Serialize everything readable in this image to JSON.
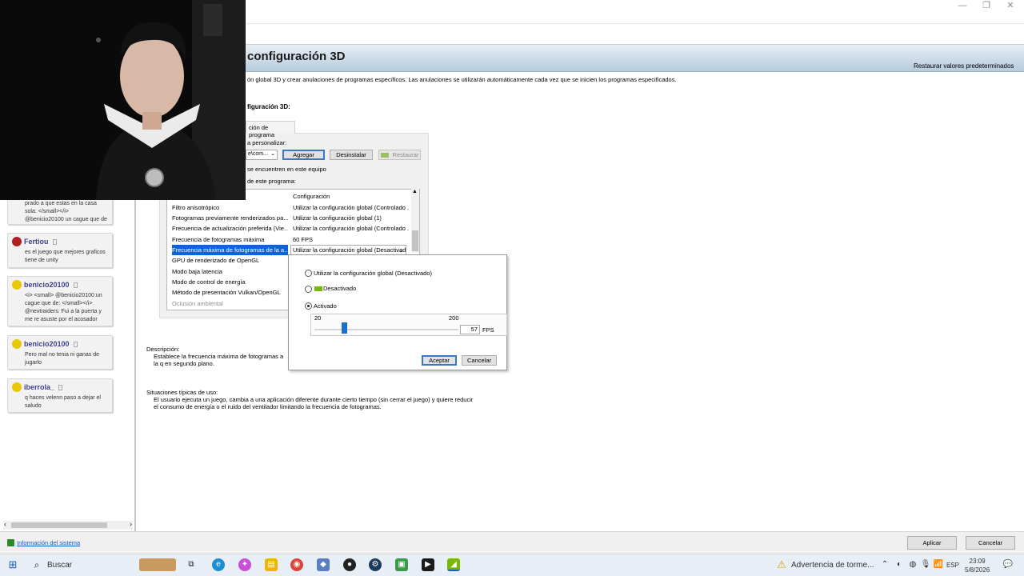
{
  "page": {
    "title": "configuración 3D",
    "restore_defaults": "Restaurar valores predeterminados",
    "intro": "ón global 3D y crear anulaciones de programas específicos. Las anulaciones se utilizarán automáticamente cada vez que se inicien los programas especificados.",
    "section_label": "figuración 3D:",
    "tab_label": "ción de programa",
    "personalize_label": "a personalizar:",
    "program_combo": "e\\com...",
    "buttons": {
      "add": "Agregar",
      "uninstall": "Desinstalar",
      "restore": "Restaurar"
    },
    "found_label": "se encuentren en este equipo",
    "settings_label": "de este programa:"
  },
  "settings_list": {
    "header": {
      "feature": "",
      "setting": "Configuración"
    },
    "rows": [
      {
        "feature": "Filtro anisotrópico",
        "setting": "Utilizar la configuración global (Controlado ..."
      },
      {
        "feature": "Fotogramas previamente renderizados pa...",
        "setting": "Utilizar la configuración global (1)"
      },
      {
        "feature": "Frecuencia de actualización preferida (Vie...",
        "setting": "Utilizar la configuración global (Controlado ..."
      },
      {
        "feature": "Frecuencia de fotogramas máxima",
        "setting": "60 FPS"
      },
      {
        "feature": "Frecuencia máxima de fotogramas de la a...",
        "setting": "Utilizar la configuración global (Desactivado"
      },
      {
        "feature": "GPU de renderizado de OpenGL",
        "setting": ""
      },
      {
        "feature": "Modo baja latencia",
        "setting": ""
      },
      {
        "feature": "Modo de control de energía",
        "setting": ""
      },
      {
        "feature": "Método de presentación Vulkan/OpenGL",
        "setting": ""
      },
      {
        "feature": "Oclusión ambiental",
        "setting": ""
      }
    ]
  },
  "popup": {
    "option_global": "Utilizar la configuración global (Desactivado)",
    "option_off": "Desactivado",
    "option_on": "Activado",
    "selected": "on",
    "min_label": "20",
    "max_label": "200",
    "value": "57",
    "unit": "FPS",
    "slider_min": 20,
    "slider_max": 200,
    "slider_value": 57,
    "accept": "Aceptar",
    "cancel": "Cancelar"
  },
  "description": {
    "title": "Descripción:",
    "text": "Establece la frecuencia máxima de fotogramas a la q en segundo plano."
  },
  "typical": {
    "title": "Situaciones típicas de uso:",
    "text": "El usuario ejecuta un juego, cambia a una aplicación diferente durante cierto tiempo (sin cerrar el juego) y quiere reducir el consumo de energía o el ruido del ventilador limitando la frecuencia de fotogramas."
  },
  "footer": {
    "system_info": "Información del sistema",
    "apply": "Aplicar",
    "cancel": "Cancelar"
  },
  "chat": [
    {
      "user": "",
      "color": "#ffffff",
      "text": "prado a que estas en la casa sola: </small></i> @benicio20100 un cague que de"
    },
    {
      "user": "Fertiou",
      "color": "#b02020",
      "text": "es el juego que mejores graficos tiene de unity"
    },
    {
      "user": "benicio20100",
      "color": "#e8c800",
      "text": "<i> <small> @benicio20100 un cague que de: </small></i> @nextraiders: Fui a la puerta y me re asuste por el acosador"
    },
    {
      "user": "benicio20100",
      "color": "#e8c800",
      "text": "Pero mal no tenia ni ganas de jugarlo"
    },
    {
      "user": "iberrola_",
      "color": "#e8c800",
      "text": "q haces velenn paso a dejar el saludo"
    }
  ],
  "taskbar": {
    "search": "Buscar",
    "weather": "Advertencia de torme...",
    "lang": "ESP",
    "time": "23:09",
    "date": "5/8/2026"
  },
  "colors": {
    "selection": "#0a64d8",
    "accent": "#3b78c4",
    "nvidia_green": "#76b900"
  }
}
